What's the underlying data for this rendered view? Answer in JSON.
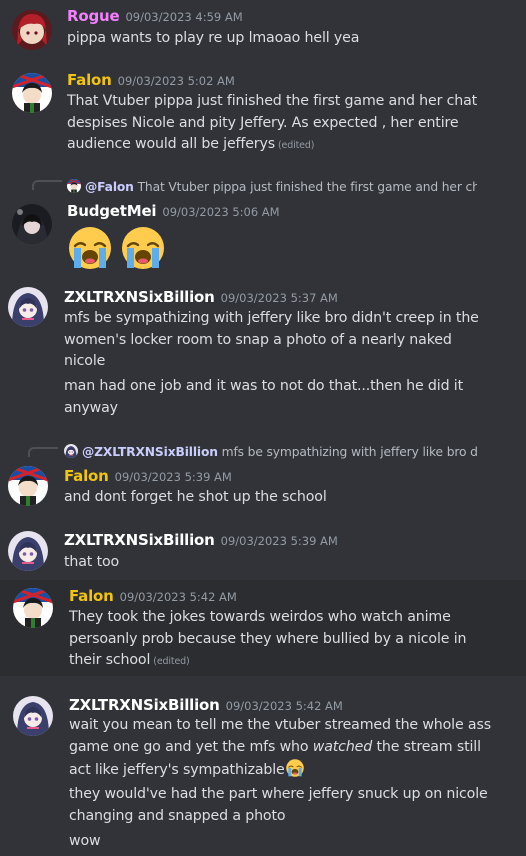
{
  "colors": {
    "rogue": "#f47fff",
    "falon": "#f1c40f",
    "budgetmei": "#ffffff",
    "zxl": "#ffffff",
    "background": "#313338",
    "hover": "#2b2d31",
    "timestamp": "#949ba4",
    "mention": "#c9cdfb"
  },
  "messages": [
    {
      "author": "Rogue",
      "timestamp": "09/03/2023 4:59 AM",
      "lines": [
        "pippa wants to play re up lmaoao hell yea"
      ]
    },
    {
      "author": "Falon",
      "timestamp": "09/03/2023 5:02 AM",
      "lines": [
        "That Vtuber pippa just finished the first game and her chat",
        "despises Nicole and pity Jeffery. As expected , her entire",
        "audience would all be jefferys"
      ],
      "edited": "(edited)"
    },
    {
      "reply": {
        "mention": "@Falon",
        "text": "That Vtuber pippa just finished the first game and her chat"
      },
      "author": "BudgetMei",
      "timestamp": "09/03/2023 5:06 AM",
      "emoji": [
        "loudly-crying-face",
        "loudly-crying-face"
      ]
    },
    {
      "author": "ZXLTRXNSixBillion",
      "timestamp": "09/03/2023 5:37 AM",
      "lines": [
        "mfs be sympathizing with jeffery like bro didn't creep in the",
        "women's locker room to snap a photo of a nearly naked",
        "nicole"
      ],
      "lines2": [
        "man had one job and it was to not do that...then he did it",
        "anyway"
      ]
    },
    {
      "reply": {
        "mention": "@ZXLTRXNSixBillion",
        "text": "mfs be sympathizing with jeffery like bro didn"
      },
      "author": "Falon",
      "timestamp": "09/03/2023 5:39 AM",
      "lines": [
        "and dont forget he shot up the school"
      ]
    },
    {
      "author": "ZXLTRXNSixBillion",
      "timestamp": "09/03/2023 5:39 AM",
      "lines": [
        "that too"
      ]
    },
    {
      "author": "Falon",
      "timestamp": "09/03/2023 5:42 AM",
      "lines": [
        "They took the jokes towards weirdos who watch anime",
        "persoanly prob because they where bullied by a nicole in",
        "their school"
      ],
      "edited": "(edited)"
    },
    {
      "author": "ZXLTRXNSixBillion",
      "timestamp": "09/03/2023 5:42 AM",
      "line_a": "wait you mean to tell me the vtuber streamed the whole ass",
      "line_b_pre": "game one go and yet the mfs who ",
      "line_b_em": "watched",
      "line_b_post": " the stream still",
      "line_c": "act like jeffery's sympathizable",
      "line_c_emoji": "loudly-crying-face",
      "lines2": [
        "they would've had the part where jeffery snuck up on nicole",
        "changing and snapped a photo"
      ],
      "lines3": [
        "wow"
      ]
    }
  ]
}
